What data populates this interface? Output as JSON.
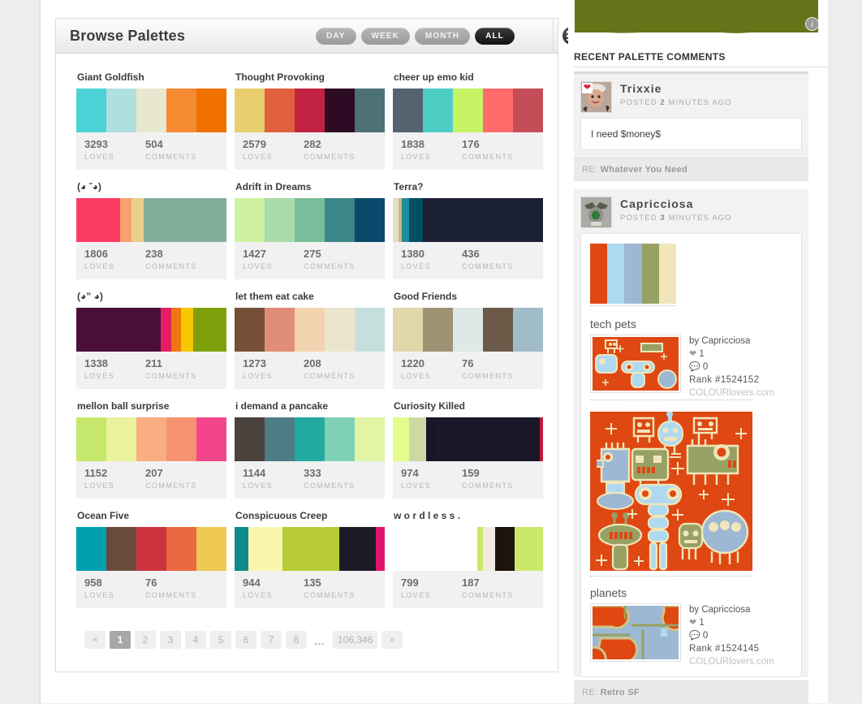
{
  "browse": {
    "title": "Browse Palettes",
    "ranges": [
      {
        "label": "DAY",
        "active": false
      },
      {
        "label": "WEEK",
        "active": false
      },
      {
        "label": "MONTH",
        "active": false
      },
      {
        "label": "ALL",
        "active": true
      }
    ],
    "views": [
      {
        "icon": "grid-view-icon",
        "active": true
      },
      {
        "icon": "list-view-icon",
        "active": false
      }
    ],
    "stat_labels": {
      "loves": "LOVES",
      "comments": "COMMENTS"
    },
    "palettes": [
      {
        "name": "Giant Goldfish",
        "loves": "3293",
        "comments": "504",
        "colors": [
          "#4bd2d6",
          "#b0e0de",
          "#e8e7cf",
          "#f58a33",
          "#f07000"
        ],
        "widths": [
          20,
          20,
          20,
          20,
          20
        ]
      },
      {
        "name": "Thought Provoking",
        "loves": "2579",
        "comments": "282",
        "colors": [
          "#e8ce6f",
          "#e0603c",
          "#c22343",
          "#2d0b24",
          "#4d7275"
        ],
        "widths": [
          20,
          20,
          20,
          20,
          20
        ]
      },
      {
        "name": "cheer up emo kid",
        "loves": "1838",
        "comments": "176",
        "colors": [
          "#556270",
          "#4ecdc4",
          "#c7f464",
          "#ff6b6b",
          "#c44d58"
        ],
        "widths": [
          20,
          20,
          20,
          20,
          20
        ]
      },
      {
        "name": "(◕ ˇ◕)",
        "loves": "1806",
        "comments": "238",
        "colors": [
          "#fb3b64",
          "#f8a070",
          "#eccf8c",
          "#82ad9b",
          "#82ad9b"
        ],
        "widths": [
          29,
          8,
          8,
          12,
          43
        ]
      },
      {
        "name": "Adrift in Dreams",
        "loves": "1427",
        "comments": "275",
        "colors": [
          "#cff09e",
          "#a8dba8",
          "#79bd9a",
          "#3b8686",
          "#0b486b"
        ],
        "widths": [
          20,
          20,
          20,
          20,
          20
        ]
      },
      {
        "name": "Terra?",
        "loves": "1380",
        "comments": "436",
        "colors": [
          "#e3ddc4",
          "#cbb884",
          "#2189a0",
          "#004f62",
          "#1b1f33"
        ],
        "widths": [
          4,
          2,
          5,
          9,
          80
        ]
      },
      {
        "name": "(◕” ◕)",
        "loves": "1338",
        "comments": "211",
        "colors": [
          "#4b0f38",
          "#e31e62",
          "#f07610",
          "#f6c800",
          "#7fa00b"
        ],
        "widths": [
          56,
          7,
          7,
          8,
          22
        ]
      },
      {
        "name": "let them eat cake",
        "loves": "1273",
        "comments": "208",
        "colors": [
          "#774f38",
          "#e08e79",
          "#f1d4af",
          "#ece5ce",
          "#c5e0dc"
        ],
        "widths": [
          20,
          20,
          20,
          20,
          20
        ]
      },
      {
        "name": "Good Friends",
        "loves": "1220",
        "comments": "76",
        "colors": [
          "#e2d6ab",
          "#9e9273",
          "#dfe8e4",
          "#6c5a48",
          "#a0bcc6"
        ],
        "widths": [
          20,
          20,
          20,
          20,
          20
        ]
      },
      {
        "name": "mellon ball surprise",
        "loves": "1152",
        "comments": "207",
        "colors": [
          "#c5e86c",
          "#eaf29c",
          "#f9ad81",
          "#f79272",
          "#f5458a"
        ],
        "widths": [
          20,
          20,
          20,
          20,
          20
        ]
      },
      {
        "name": "i demand a pancake",
        "loves": "1144",
        "comments": "333",
        "colors": [
          "#4a423c",
          "#4e7c84",
          "#22aaa1",
          "#7fd1b5",
          "#e1f5a4"
        ],
        "widths": [
          20,
          20,
          20,
          20,
          20
        ]
      },
      {
        "name": "Curiosity Killed",
        "loves": "974",
        "comments": "159",
        "colors": [
          "#e4fc8d",
          "#ccd9a4",
          "#171526",
          "#191728",
          "#c21a38"
        ],
        "widths": [
          11,
          11,
          7,
          69,
          2
        ]
      },
      {
        "name": "Ocean Five",
        "loves": "958",
        "comments": "76",
        "colors": [
          "#00a0b0",
          "#6a4a3c",
          "#cc333f",
          "#eb6841",
          "#edc951"
        ],
        "widths": [
          20,
          20,
          20,
          20,
          20
        ]
      },
      {
        "name": "Conspicuous Creep",
        "loves": "944",
        "comments": "135",
        "colors": [
          "#0f8b8d",
          "#faf6ad",
          "#b9cb36",
          "#1d1c26",
          "#e2126b"
        ],
        "widths": [
          9,
          23,
          38,
          24,
          6
        ]
      },
      {
        "name": "w o r d l e s s .",
        "loves": "799",
        "comments": "187",
        "colors": [
          "#ffffff",
          "#cbe86b",
          "#f2e9e1",
          "#1c140d",
          "#cbe86b"
        ],
        "widths": [
          56,
          4,
          8,
          13,
          19
        ]
      }
    ],
    "pagination": {
      "prev": "«",
      "pages": [
        "1",
        "2",
        "3",
        "4",
        "5",
        "6",
        "7",
        "8"
      ],
      "current": "1",
      "ellipsis": "...",
      "last": "106,346",
      "next": "»"
    }
  },
  "sidebar": {
    "banner_color": "#667419",
    "info_icon_label": "i",
    "heading": "RECENT PALETTE COMMENTS",
    "comments": [
      {
        "user": "Trixxie",
        "posted_prefix": "POSTED",
        "posted_value": "2",
        "posted_suffix": "MINUTES AGO",
        "body": "I need $money$",
        "re_label": "RE:",
        "re_title": "Whatever You Need"
      },
      {
        "user": "Capricciosa",
        "posted_prefix": "POSTED",
        "posted_value": "3",
        "posted_suffix": "MINUTES AGO",
        "palette_colors": [
          "#df4813",
          "#afd9f0",
          "#9cb8d3",
          "#97a163",
          "#f0e6ba"
        ],
        "patterns": [
          {
            "title": "tech pets",
            "by": "by Capricciosa",
            "loves": "1",
            "comments": "0",
            "rank": "Rank  #1524152",
            "site": "COLOURlovers.com"
          },
          {
            "title": "planets",
            "by": "by Capricciosa",
            "loves": "1",
            "comments": "0",
            "rank": "Rank  #1524145",
            "site": "COLOURlovers.com"
          }
        ],
        "re_label": "RE:",
        "re_title": "Retro SF"
      }
    ]
  }
}
